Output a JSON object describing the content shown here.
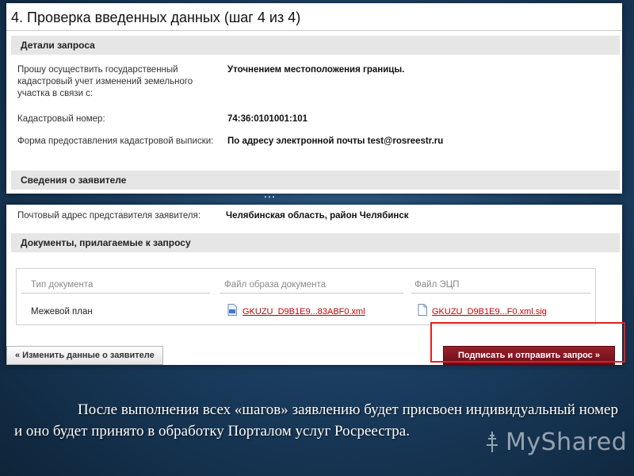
{
  "step": {
    "title_main": "4. Проверка введенных данных",
    "title_suffix": "(шаг 4 из 4)"
  },
  "request_details": {
    "header": "Детали запроса",
    "fields": [
      {
        "label": "Прошу осуществить государственный кадастровый учет изменений земельного участка в связи с:",
        "value": "Уточнением местоположения границы."
      },
      {
        "label": "Кадастровый номер:",
        "value": "74:36:0101001:101"
      },
      {
        "label": "Форма предоставления кадастровой выписки:",
        "value": "По адресу электронной почты test@rosreestr.ru"
      }
    ]
  },
  "applicant": {
    "header": "Сведения о заявителе",
    "ellipsis": "…",
    "postal_label": "Почтовый адрес представителя заявителя:",
    "postal_value": "Челябинская область, район Челябинск"
  },
  "documents": {
    "header": "Документы, прилагаемые к запросу",
    "columns": [
      "Тип документа",
      "Файл образа документа",
      "Файл ЭЦП"
    ],
    "rows": [
      {
        "type": "Межевой план",
        "image_file": "GKUZU_D9B1E9...83ABF0.xml",
        "sig_file": "GKUZU_D9B1E9...F0.xml.sig"
      }
    ]
  },
  "buttons": {
    "change_applicant": "« Изменить данные о заявителе",
    "sign_submit": "Подписать и отправить запрос »"
  },
  "caption": "После выполнения всех «шагов» заявлению будет присвоен индивидуальный номер и оно будет принято в обработку Порталом услуг Росреестра.",
  "watermark": "MyShared",
  "colors": {
    "submit_button": "#7a1420",
    "link": "#cc0000",
    "highlight": "#e0201e",
    "background": "#1b3f63"
  }
}
